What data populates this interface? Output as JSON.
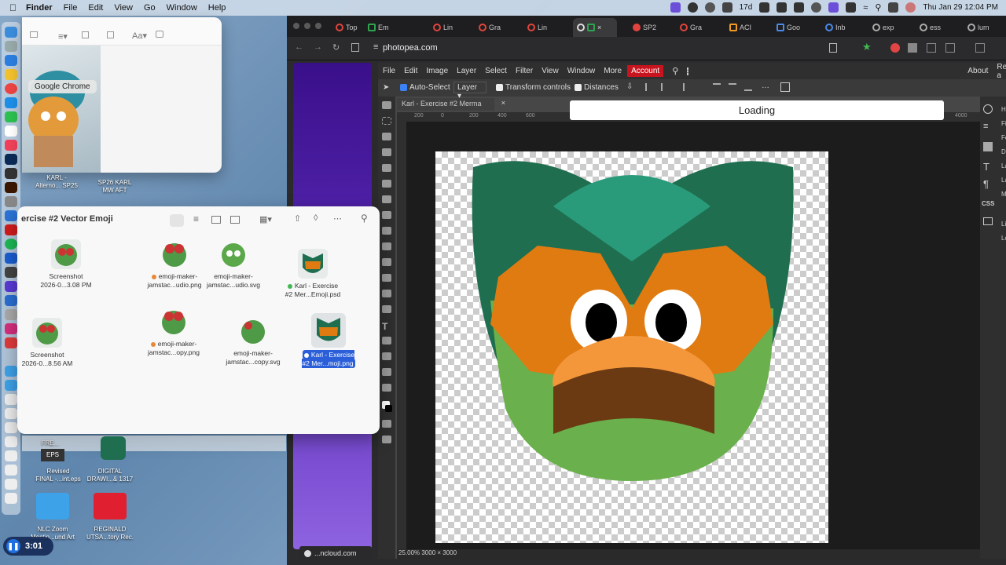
{
  "menubar": {
    "items": [
      "Finder",
      "File",
      "Edit",
      "View",
      "Go",
      "Window",
      "Help"
    ],
    "battery": "17d",
    "datetime": "Thu Jan 29  12:04 PM"
  },
  "chrome": {
    "tabs": [
      "Top",
      "Em",
      "Lin",
      "Gra",
      "Lin",
      "",
      "",
      "SP2",
      "Gra",
      "ACI",
      "Goo",
      "Inb",
      "exp",
      "ess",
      "lum"
    ],
    "url": "photopea.com",
    "side_footer": "...ncloud.com"
  },
  "photopea": {
    "menu": [
      "File",
      "Edit",
      "Image",
      "Layer",
      "Select",
      "Filter",
      "View",
      "Window",
      "More",
      "Account"
    ],
    "menu_right": [
      "About",
      "Report a"
    ],
    "options": {
      "auto_select": "Auto-Select",
      "layer_select": "Layer",
      "transform": "Transform controls",
      "distances": "Distances"
    },
    "doc_tab": "Karl - Exercise #2 Merma",
    "loading": "Loading",
    "ruler_ticks": [
      "200",
      "0",
      "200",
      "400",
      "600",
      "4000"
    ],
    "status": "25.00%   3000 × 3000",
    "right_letters": [
      "H",
      "Fi",
      "Fo",
      "D",
      "La",
      "La",
      "M",
      "Li",
      "Lo"
    ],
    "right_css": "CSS"
  },
  "finder_top": {
    "tooltip": "Google Chrome"
  },
  "finder_main": {
    "title": "ercise #2 Vector Emoji",
    "items": [
      {
        "label": "Screenshot\n2026-0...3.08 PM",
        "tag": ""
      },
      {
        "label": "emoji-maker-\njamstac...udio.png",
        "tag": "#e8893a"
      },
      {
        "label": "emoji-maker-\njamstac...udio.svg",
        "tag": ""
      },
      {
        "label": "Karl - Exercise\n#2 Mer...Emoji.psd",
        "tag": "#3fb950"
      },
      {
        "label": "Screenshot\n2026-0...8.56 AM",
        "tag": ""
      },
      {
        "label": "emoji-maker-\njamstac...opy.png",
        "tag": "#e8893a"
      },
      {
        "label": "emoji-maker-\njamstac...copy.svg",
        "tag": ""
      },
      {
        "label": "Karl - Exercise\n#2 Mer...moji.png",
        "tag": "#2b5fd9"
      }
    ]
  },
  "desktop": {
    "labels": [
      "KARL -\nAlterno... SP25",
      "SP26 KARL\nMW AFT",
      "FRE...",
      "EPS",
      "Revised\nFINAL -...int.eps",
      "DIGITAL\nDRAWI...& 1317",
      "NLC Zoom\nMeetin...und Art",
      "REGINALD\nUTSA...tory Rec."
    ]
  },
  "timer": "3:01"
}
